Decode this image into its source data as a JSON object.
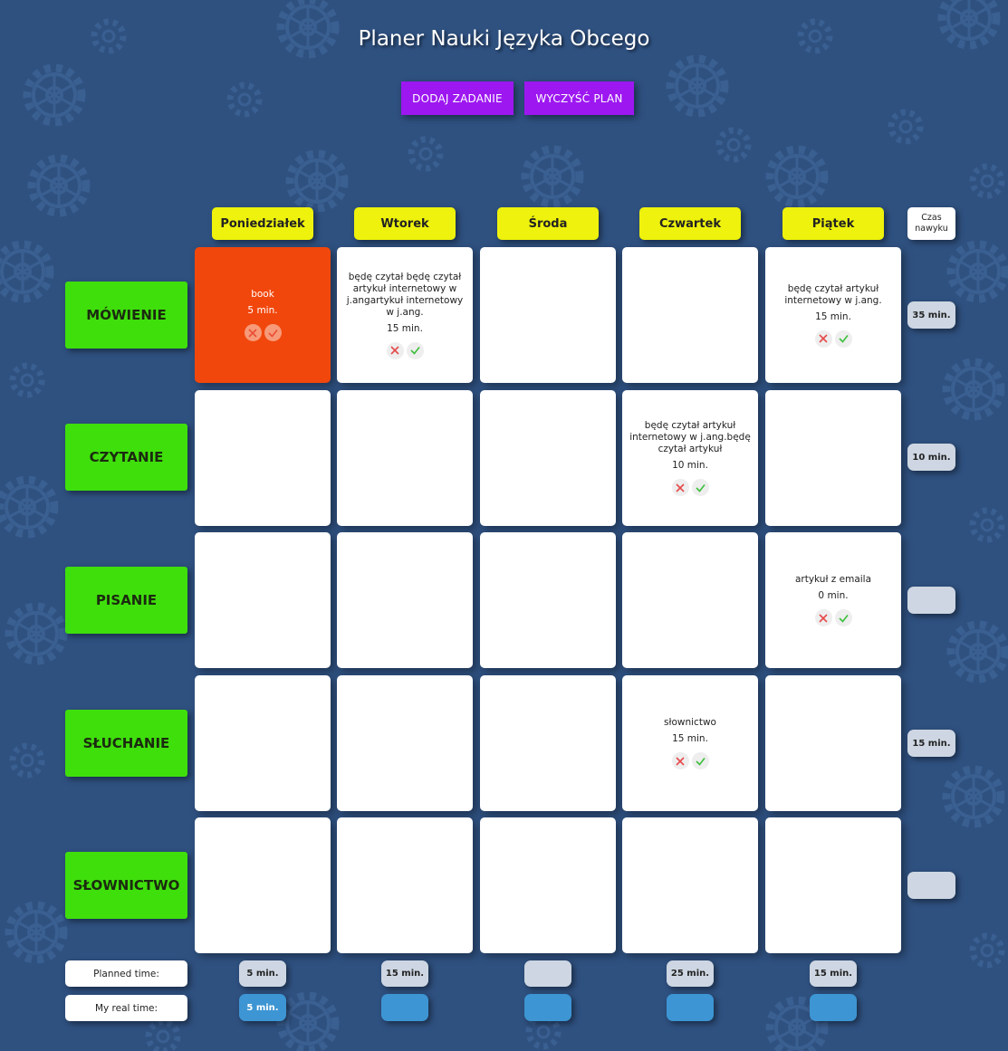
{
  "app": {
    "title": "Planer Nauki Języka Obcego"
  },
  "toolbar": {
    "add_label": "DODAJ ZADANIE",
    "clear_label": "WYCZYŚĆ PLAN"
  },
  "days": [
    "Poniedziałek",
    "Wtorek",
    "Środa",
    "Czwartek",
    "Piątek"
  ],
  "habit_header": {
    "line1": "Czas",
    "line2": "nawyku"
  },
  "skills": [
    "MÓWIENIE",
    "CZYTANIE",
    "PISANIE",
    "SŁUCHANIE",
    "SŁOWNICTWO"
  ],
  "tasks": {
    "mowienie_pon": {
      "text": "book",
      "time": "5 min.",
      "done": true
    },
    "mowienie_wt": {
      "text": "będę czytał będę czytał artykuł internetowy w j.angartykuł internetowy w j.ang.",
      "time": "15 min."
    },
    "mowienie_pt": {
      "text": "będę czytał artykuł internetowy w j.ang.",
      "time": "15 min."
    },
    "czytanie_czw": {
      "text": "będę czytał artykuł internetowy w j.ang.będę czytał artykuł",
      "time": "10 min."
    },
    "pisanie_pt": {
      "text": "artykuł z emaila",
      "time": "0 min."
    },
    "sluchanie_czw": {
      "text": "słownictwo",
      "time": "15 min."
    }
  },
  "habit_times": [
    "35 min.",
    "10 min.",
    "",
    "15 min.",
    ""
  ],
  "planned": {
    "label": "Planned time:",
    "values": [
      "5 min.",
      "15 min.",
      "",
      "25 min.",
      "15 min."
    ]
  },
  "real": {
    "label": "My real time:",
    "values": [
      "5 min.",
      "",
      "",
      "",
      ""
    ]
  },
  "icons": {
    "delete": "close-icon",
    "complete": "check-icon",
    "background": "gear-pattern"
  },
  "colors": {
    "background": "#2f5180",
    "button": "#9d17f0",
    "day_header": "#eef20c",
    "skill": "#3fdf0c",
    "done_task": "#f1470c",
    "habit_pill": "#cdd6e2",
    "real_time_pill": "#3d95d3"
  }
}
